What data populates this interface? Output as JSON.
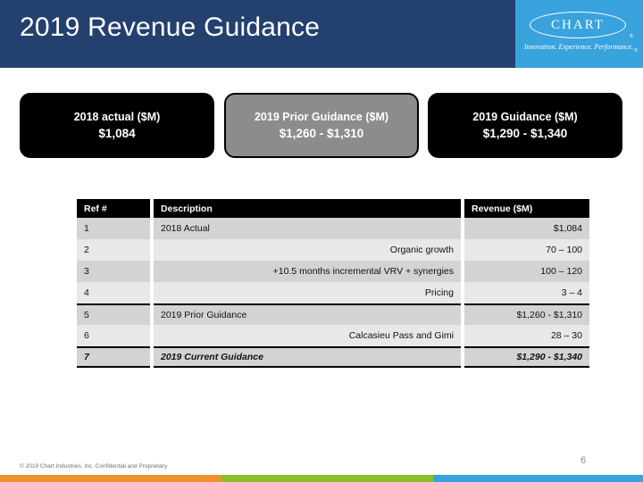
{
  "header": {
    "title": "2019 Revenue Guidance",
    "brand_bg": "#24406e",
    "logo": {
      "wordmark": "CHART",
      "trademark": "®",
      "tagline": "Innovation. Experience. Performance.",
      "tagline_mark": "®",
      "panel_color": "#39a3dd"
    }
  },
  "callouts": [
    {
      "name": "2018-actual",
      "title": "2018 actual ($M)",
      "value": "$1,084",
      "bg": "#000000",
      "text": "#ffffff"
    },
    {
      "name": "2019-prior-guidance",
      "title": "2019 Prior Guidance ($M)",
      "value": "$1,260 - $1,310",
      "bg": "#8c8c8c",
      "text": "#ffffff"
    },
    {
      "name": "2019-guidance",
      "title": "2019 Guidance ($M)",
      "value": "$1,290 - $1,340",
      "bg": "#000000",
      "text": "#ffffff"
    }
  ],
  "table": {
    "columns": [
      "Ref #",
      "Description",
      "Revenue ($M)"
    ],
    "rows": [
      {
        "ref": "1",
        "description": "2018 Actual",
        "revenue": "$1,084",
        "desc_align": "left",
        "shade": "dark",
        "style": "normal"
      },
      {
        "ref": "2",
        "description": "Organic growth",
        "revenue": "70 – 100",
        "desc_align": "right",
        "shade": "light",
        "style": "normal"
      },
      {
        "ref": "3",
        "description": "+10.5 months incremental VRV + synergies",
        "revenue": "100 – 120",
        "desc_align": "right",
        "shade": "dark",
        "style": "normal"
      },
      {
        "ref": "4",
        "description": "Pricing",
        "revenue": "3 – 4",
        "desc_align": "right",
        "shade": "light",
        "style": "normal"
      },
      {
        "ref": "5",
        "description": "2019 Prior Guidance",
        "revenue": "$1,260 - $1,310",
        "desc_align": "left",
        "shade": "dark",
        "style": "subtotal"
      },
      {
        "ref": "6",
        "description": "Calcasieu Pass and Gimi",
        "revenue": "28 – 30",
        "desc_align": "right",
        "shade": "light",
        "style": "normal"
      },
      {
        "ref": "7",
        "description": "2019 Current Guidance",
        "revenue": "$1,290 - $1,340",
        "desc_align": "left",
        "shade": "dark",
        "style": "total"
      }
    ]
  },
  "footer": {
    "copyright": "© 2019 Chart Industries, Inc. Confidential and Proprietary",
    "page_number": "6",
    "accent_bar": {
      "orange": "#f0932f",
      "green": "#8cbf26",
      "blue": "#39a3dd"
    }
  }
}
